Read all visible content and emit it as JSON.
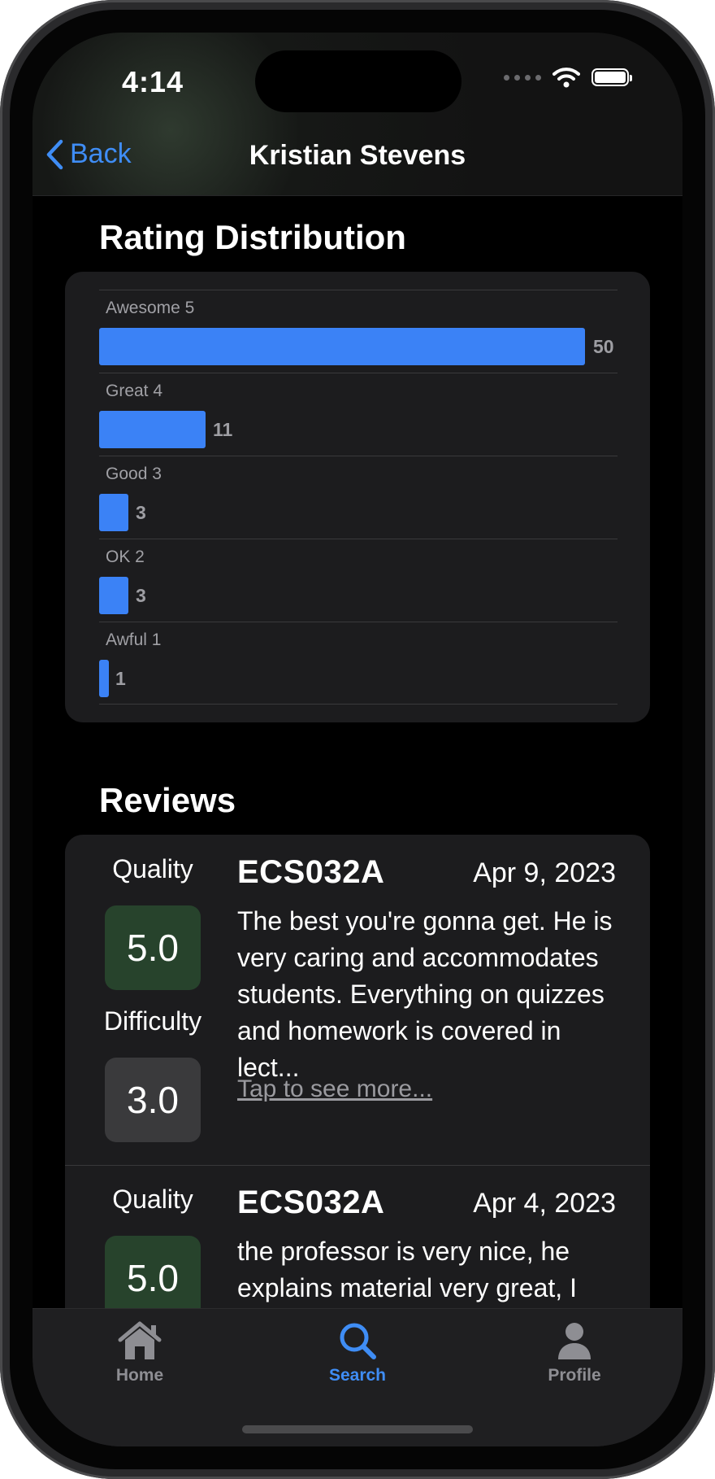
{
  "status_bar": {
    "time": "4:14"
  },
  "nav": {
    "back_label": "Back",
    "title": "Kristian Stevens"
  },
  "rating_distribution": {
    "title": "Rating Distribution",
    "rows": [
      {
        "label": "Awesome 5",
        "count": "50"
      },
      {
        "label": "Great 4",
        "count": "11"
      },
      {
        "label": "Good 3",
        "count": "3"
      },
      {
        "label": "OK 2",
        "count": "3"
      },
      {
        "label": "Awful 1",
        "count": "1"
      }
    ],
    "bar_color": "#3b82f6"
  },
  "reviews": {
    "title": "Reviews",
    "items": [
      {
        "quality_label": "Quality",
        "quality": "5.0",
        "difficulty_label": "Difficulty",
        "difficulty": "3.0",
        "course": "ECS032A",
        "date": "Apr 9, 2023",
        "text": "The best you're gonna get. He is very caring and accommodates students. Everything on quizzes and homework is covered in lect...",
        "more_label": "Tap to see more..."
      },
      {
        "quality_label": "Quality",
        "quality": "5.0",
        "course": "ECS032A",
        "date": "Apr 4, 2023",
        "text": "the professor is very nice, he explains material very great, I"
      }
    ]
  },
  "tab_bar": {
    "tabs": [
      {
        "label": "Home",
        "icon": "house-icon",
        "active": false
      },
      {
        "label": "Search",
        "icon": "magnifier-icon",
        "active": true
      },
      {
        "label": "Profile",
        "icon": "person-icon",
        "active": false
      }
    ]
  },
  "colors": {
    "accent": "#3f8df5",
    "quality_bg": "#27432c",
    "difficulty_bg": "#3a3a3c",
    "card_bg": "#1c1c1e"
  }
}
